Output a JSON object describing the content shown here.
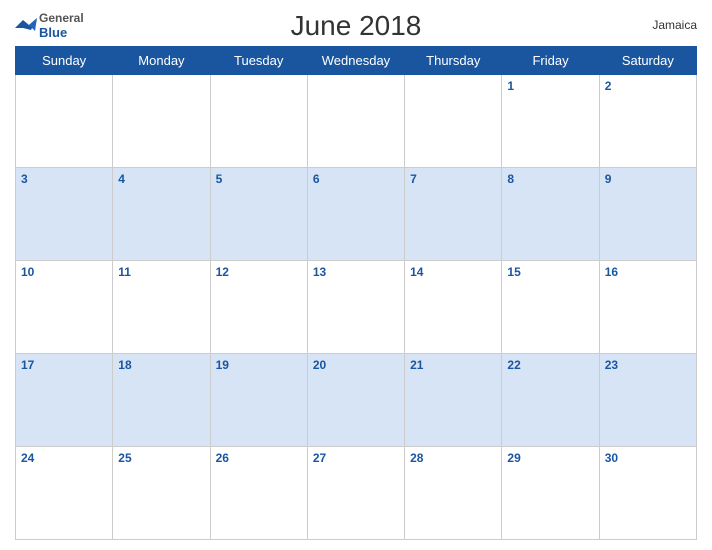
{
  "header": {
    "title": "June 2018",
    "country": "Jamaica",
    "logo": {
      "line1": "General",
      "line2": "Blue"
    }
  },
  "weekdays": [
    "Sunday",
    "Monday",
    "Tuesday",
    "Wednesday",
    "Thursday",
    "Friday",
    "Saturday"
  ],
  "weeks": [
    [
      null,
      null,
      null,
      null,
      null,
      1,
      2
    ],
    [
      3,
      4,
      5,
      6,
      7,
      8,
      9
    ],
    [
      10,
      11,
      12,
      13,
      14,
      15,
      16
    ],
    [
      17,
      18,
      19,
      20,
      21,
      22,
      23
    ],
    [
      24,
      25,
      26,
      27,
      28,
      29,
      30
    ]
  ]
}
